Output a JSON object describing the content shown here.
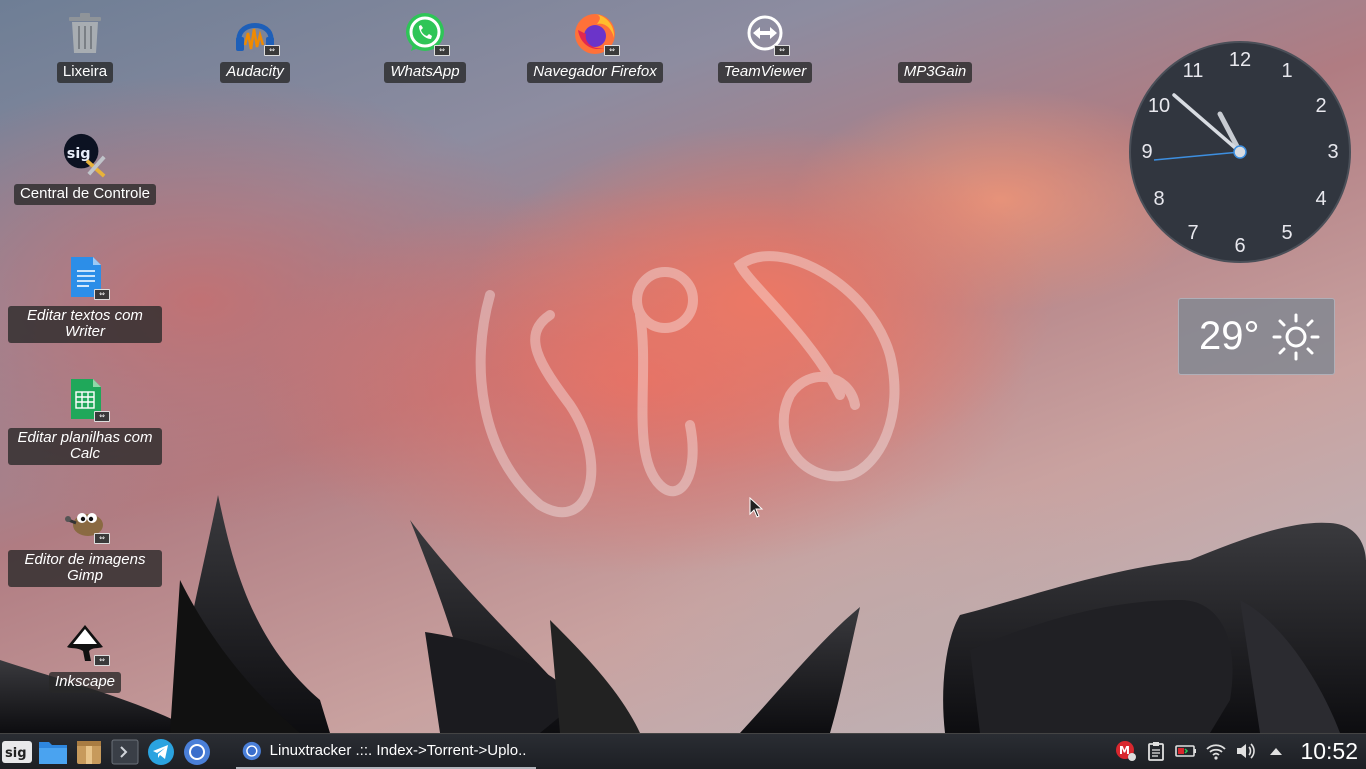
{
  "desktop": {
    "icons": [
      {
        "label": "Lixeira",
        "icon": "trash-icon"
      },
      {
        "label": "Audacity",
        "icon": "audacity-icon"
      },
      {
        "label": "WhatsApp",
        "icon": "whatsapp-icon"
      },
      {
        "label": "Navegador Firefox",
        "icon": "firefox-icon"
      },
      {
        "label": "TeamViewer",
        "icon": "teamviewer-icon"
      },
      {
        "label": "MP3Gain",
        "icon": "mp3gain-icon"
      },
      {
        "label": "Central de Controle",
        "icon": "control-center-icon"
      },
      {
        "label": "Editar textos com Writer",
        "icon": "writer-icon"
      },
      {
        "label": "Editar planilhas com Calc",
        "icon": "calc-icon"
      },
      {
        "label": "Editor de imagens Gimp",
        "icon": "gimp-icon"
      },
      {
        "label": "Inkscape",
        "icon": "inkscape-icon"
      }
    ]
  },
  "clock_widget": {
    "numbers": [
      "12",
      "1",
      "2",
      "3",
      "4",
      "5",
      "6",
      "7",
      "8",
      "9",
      "10",
      "11"
    ],
    "face_color": "#31363f",
    "hand_color": "#d8dce2",
    "second_hand_color": "#3d8fe0"
  },
  "weather_widget": {
    "temperature": "29°",
    "condition_icon": "sun-icon"
  },
  "taskbar": {
    "launchers": [
      "sig-menu-icon",
      "file-manager-icon",
      "archive-icon",
      "terminal-icon",
      "telegram-icon",
      "chromium-icon"
    ],
    "active_task": {
      "title": "Linuxtracker .::. Index->Torrent->Uplo...",
      "icon": "chromium-icon"
    },
    "tray": [
      "mega-icon",
      "clipboard-icon",
      "battery-icon",
      "wifi-icon",
      "volume-icon",
      "expand-tray-icon"
    ],
    "time": "10:52"
  }
}
